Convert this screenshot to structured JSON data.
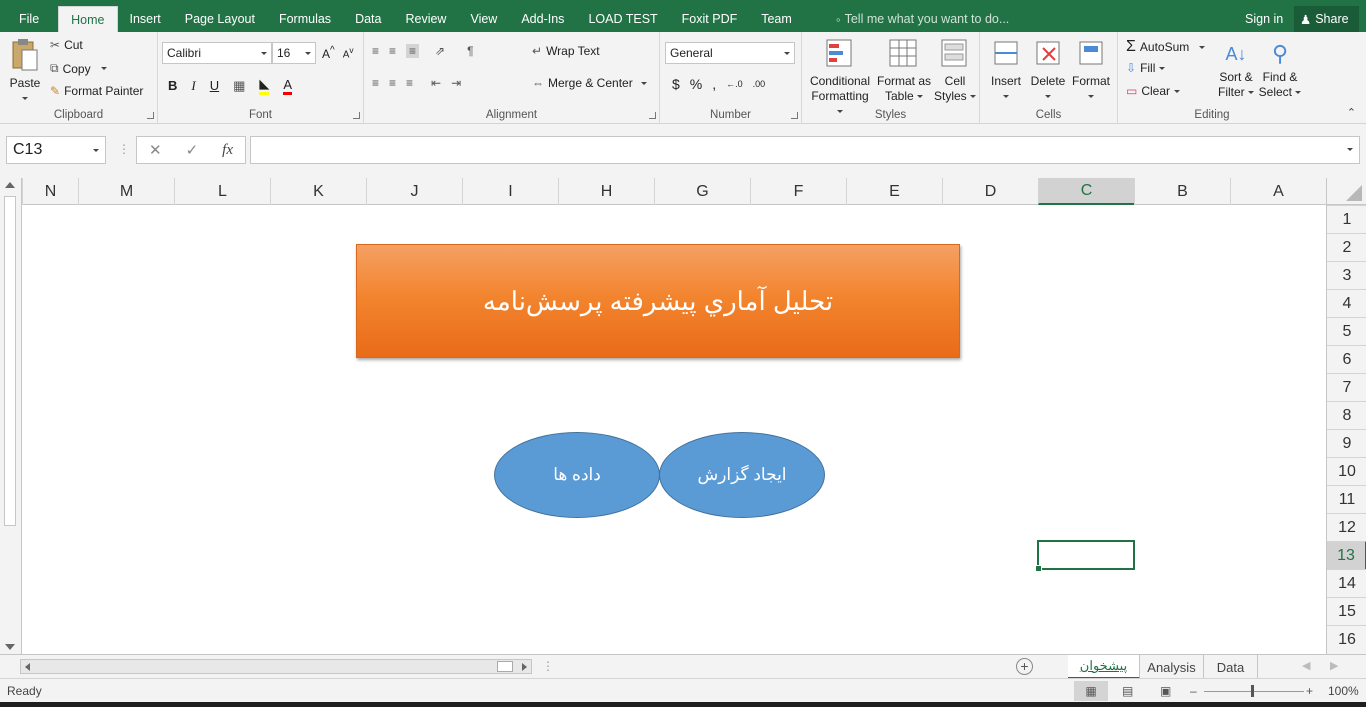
{
  "ribbon_tabs": [
    "File",
    "Home",
    "Insert",
    "Page Layout",
    "Formulas",
    "Data",
    "Review",
    "View",
    "Add-Ins",
    "LOAD TEST",
    "Foxit PDF",
    "Team"
  ],
  "tell_me": "Tell me what you want to do...",
  "sign_in": "Sign in",
  "share": "Share",
  "clipboard": {
    "paste": "Paste",
    "cut": "Cut",
    "copy": "Copy",
    "format_painter": "Format Painter",
    "label": "Clipboard"
  },
  "font": {
    "name": "Calibri",
    "size": "16",
    "bold": "B",
    "italic": "I",
    "underline": "U",
    "label": "Font"
  },
  "alignment": {
    "wrap_text": "Wrap Text",
    "merge_center": "Merge & Center",
    "label": "Alignment"
  },
  "number": {
    "format": "General",
    "currency": "$",
    "percent": "%",
    "comma": ",",
    "label": "Number"
  },
  "styles": {
    "conditional": [
      "Conditional",
      "Formatting"
    ],
    "format_table": [
      "Format as",
      "Table"
    ],
    "cell_styles": [
      "Cell",
      "Styles"
    ],
    "label": "Styles"
  },
  "cells": {
    "insert": "Insert",
    "delete": "Delete",
    "format": "Format",
    "label": "Cells"
  },
  "editing": {
    "autosum": "AutoSum",
    "fill": "Fill",
    "clear": "Clear",
    "sort": [
      "Sort &",
      "Filter"
    ],
    "find": [
      "Find &",
      "Select"
    ],
    "label": "Editing"
  },
  "name_box": "C13",
  "formula_value": "",
  "columns": [
    "N",
    "M",
    "L",
    "K",
    "J",
    "I",
    "H",
    "G",
    "F",
    "E",
    "D",
    "C",
    "B",
    "A"
  ],
  "selected_column": "C",
  "rows": [
    "1",
    "2",
    "3",
    "4",
    "5",
    "6",
    "7",
    "8",
    "9",
    "10",
    "11",
    "12",
    "13",
    "14",
    "15",
    "16"
  ],
  "selected_row": "13",
  "banner_text": "تحليل آماري پيشرفته پرسش‌نامه",
  "shapes": {
    "left_oval": "داده ها",
    "right_oval": "ایجاد گزارش"
  },
  "sheets": [
    "پیشخوان",
    "Analysis",
    "Data"
  ],
  "active_sheet": "پیشخوان",
  "status": "Ready",
  "zoom": "100%",
  "colors": {
    "accent": "#217346",
    "banner": "#f3852f",
    "oval": "#5b9bd5"
  }
}
